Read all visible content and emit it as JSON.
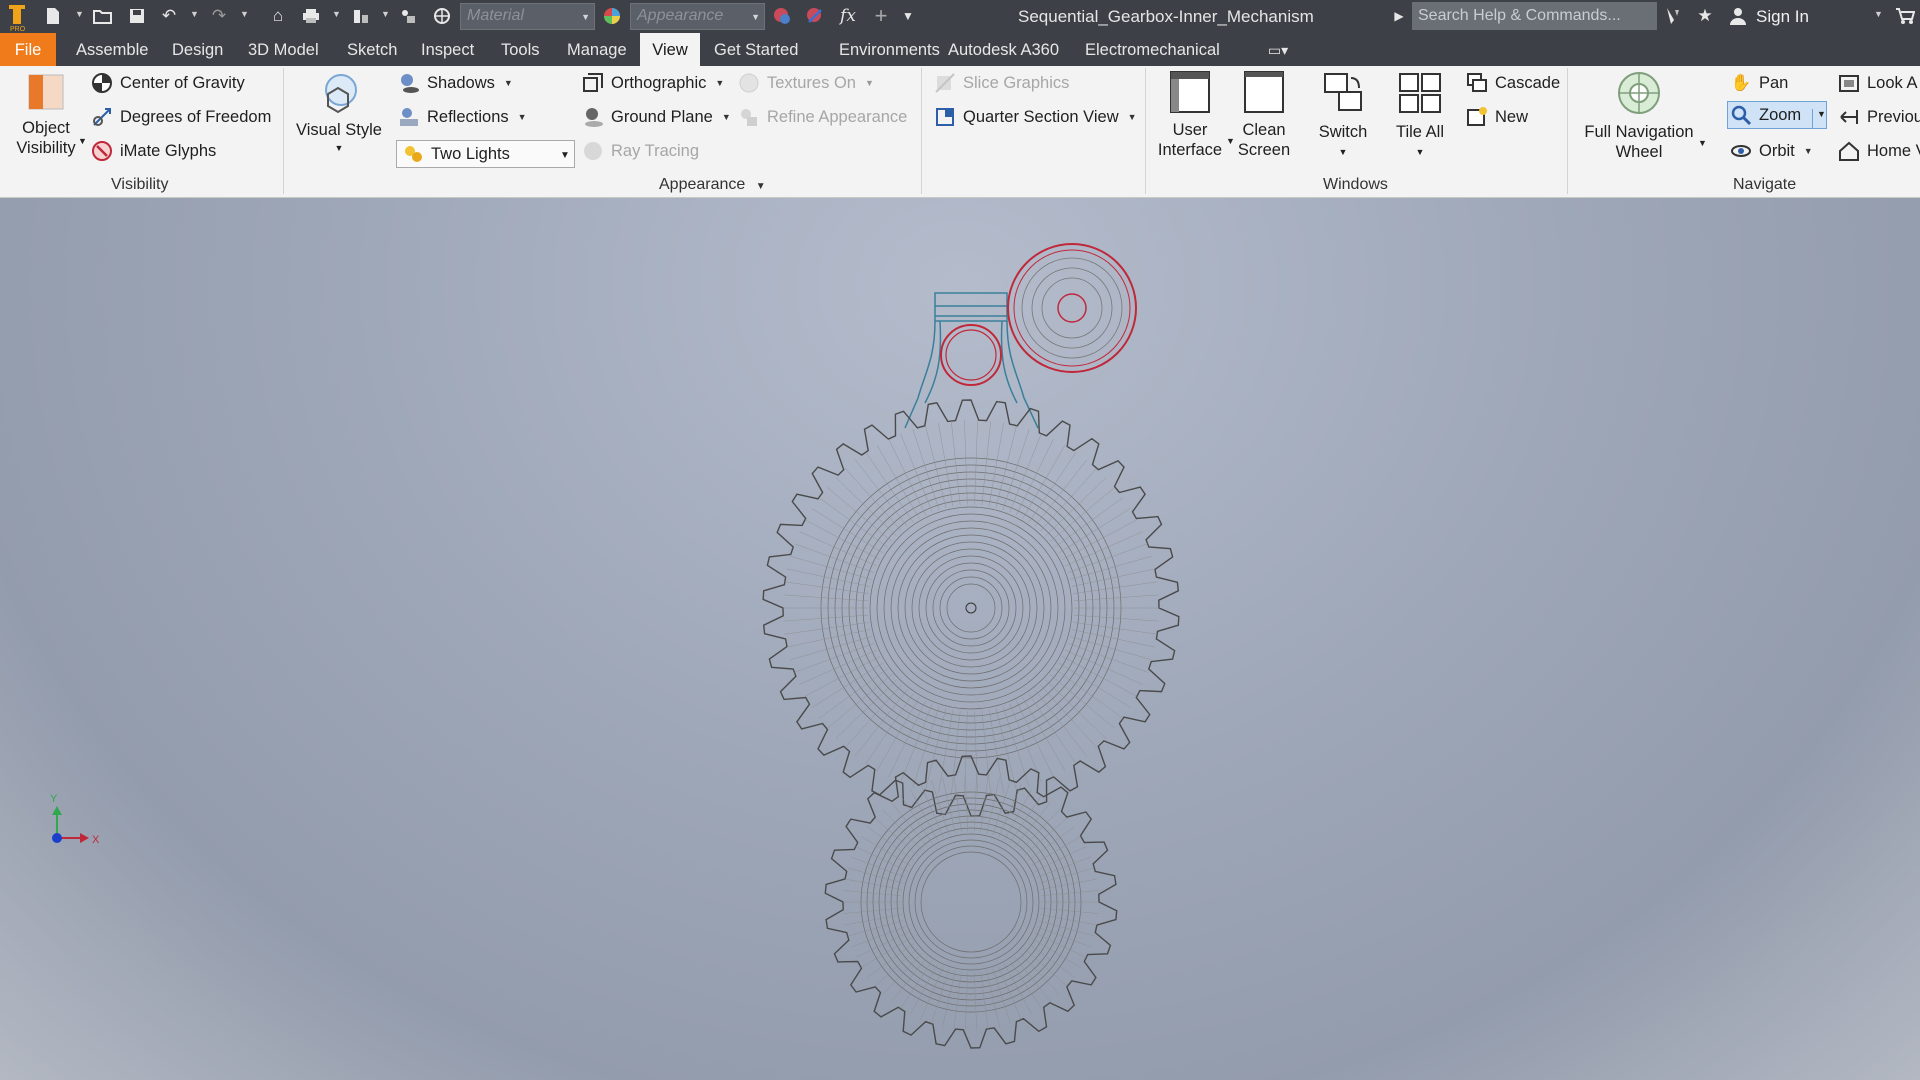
{
  "app": {
    "document_title": "Sequential_Gearbox-Inner_Mechanism",
    "material_placeholder": "Material",
    "appearance_placeholder": "Appearance",
    "search_placeholder": "Search Help & Commands...",
    "sign_in": "Sign In"
  },
  "quick_access_icons": [
    "logo-icon",
    "new-icon",
    "open-icon",
    "save-icon",
    "undo-icon",
    "redo-icon",
    "home-icon",
    "print-icon",
    "measure-icon",
    "project-icon",
    "web-icon",
    "color-icon",
    "color-override-icon",
    "function-icon",
    "plus-icon",
    "customize-icon"
  ],
  "tabs": [
    "File",
    "Assemble",
    "Design",
    "3D Model",
    "Sketch",
    "Inspect",
    "Tools",
    "Manage",
    "View",
    "Get Started",
    "Environments",
    "Autodesk A360",
    "Electromechanical"
  ],
  "active_tab": "View",
  "ribbon": {
    "visibility": {
      "title": "Visibility",
      "object_visibility_line1": "Object",
      "object_visibility_line2": "Visibility",
      "center_of_gravity": "Center of Gravity",
      "degrees_of_freedom": "Degrees of Freedom",
      "imate_glyphs": "iMate Glyphs"
    },
    "appearance": {
      "title": "Appearance",
      "visual_style": "Visual Style",
      "shadows": "Shadows",
      "reflections": "Reflections",
      "lighting": "Two Lights",
      "orthographic": "Orthographic",
      "ground_plane": "Ground Plane",
      "textures_on": "Textures On",
      "refine_appearance": "Refine Appearance",
      "ray_tracing": "Ray Tracing",
      "slice_graphics": "Slice Graphics",
      "quarter_section_view": "Quarter Section View"
    },
    "windows": {
      "title": "Windows",
      "user_interface_line1": "User",
      "user_interface_line2": "Interface",
      "clean_screen_line1": "Clean",
      "clean_screen_line2": "Screen",
      "switch": "Switch",
      "tile_all": "Tile All",
      "cascade": "Cascade",
      "new": "New"
    },
    "navigate": {
      "title": "Navigate",
      "full_nav_wheel_line1": "Full Navigation",
      "full_nav_wheel_line2": "Wheel",
      "pan": "Pan",
      "zoom": "Zoom",
      "orbit": "Orbit",
      "look_at": "Look A",
      "previous": "Previou",
      "home": "Home V"
    }
  },
  "viewcube_axes": {
    "x": "X",
    "y": "Y"
  },
  "colors": {
    "file_tab": "#f07b1a",
    "titlebar": "#3d4147",
    "ribbon_bg": "#f3f3f3",
    "highlight_red": "#c0283a",
    "highlight_teal": "#3a7f9a",
    "wire": "#4a4a4a"
  }
}
